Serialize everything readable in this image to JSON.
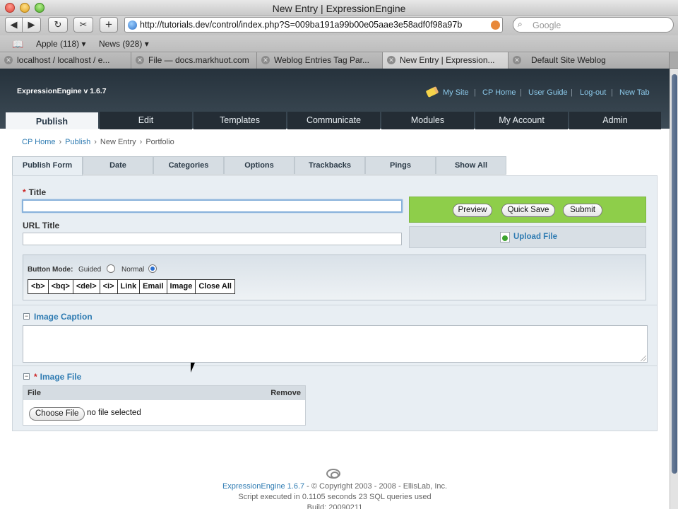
{
  "window": {
    "title": "New Entry | ExpressionEngine"
  },
  "browser": {
    "url": "http://tutorials.dev/control/index.php?S=009ba191a99b00e05aae3e58adf0f98a97b",
    "search_placeholder": "Google",
    "bookmarks": [
      {
        "label": "Apple (118)"
      },
      {
        "label": "News (928)"
      }
    ],
    "tabs": [
      {
        "label": "localhost / localhost / e..."
      },
      {
        "label": "File — docs.markhuot.com"
      },
      {
        "label": "Weblog Entries Tag Par..."
      },
      {
        "label": "New Entry | Expression..."
      },
      {
        "label": "Default Site Weblog"
      }
    ]
  },
  "header": {
    "brand": "ExpressionEngine  v 1.6.7",
    "links": [
      "My Site",
      "CP Home",
      "User Guide",
      "Log-out",
      "New Tab"
    ]
  },
  "nav": {
    "tabs": [
      "Publish",
      "Edit",
      "Templates",
      "Communicate",
      "Modules",
      "My Account",
      "Admin"
    ]
  },
  "breadcrumb": [
    "CP Home",
    "Publish",
    "New Entry",
    "Portfolio"
  ],
  "publish_tabs": [
    "Publish Form",
    "Date",
    "Categories",
    "Options",
    "Trackbacks",
    "Pings",
    "Show All"
  ],
  "form": {
    "title_label": "Title",
    "required_mark": "*",
    "title_value": "",
    "url_title_label": "URL Title",
    "url_title_value": "",
    "buttons": {
      "preview": "Preview",
      "quick_save": "Quick Save",
      "submit": "Submit"
    },
    "upload_label": "Upload File",
    "button_mode_label": "Button Mode:",
    "mode_guided": "Guided",
    "mode_normal": "Normal",
    "mode_selected": "Normal",
    "format_buttons": [
      "<b>",
      "<bq>",
      "<del>",
      "<i>",
      "Link",
      "Email",
      "Image",
      "Close All"
    ],
    "image_caption_label": "Image Caption",
    "image_file_label": "Image File",
    "file_header": "File",
    "remove_header": "Remove",
    "choose_file": "Choose File",
    "no_file": "no file selected"
  },
  "footer": {
    "product": "ExpressionEngine 1.6.7",
    "copyright": " - © Copyright 2003 - 2008 - EllisLab, Inc.",
    "stats": "Script executed in 0.1105 seconds   23 SQL queries used",
    "build": "Build:  20090211"
  }
}
